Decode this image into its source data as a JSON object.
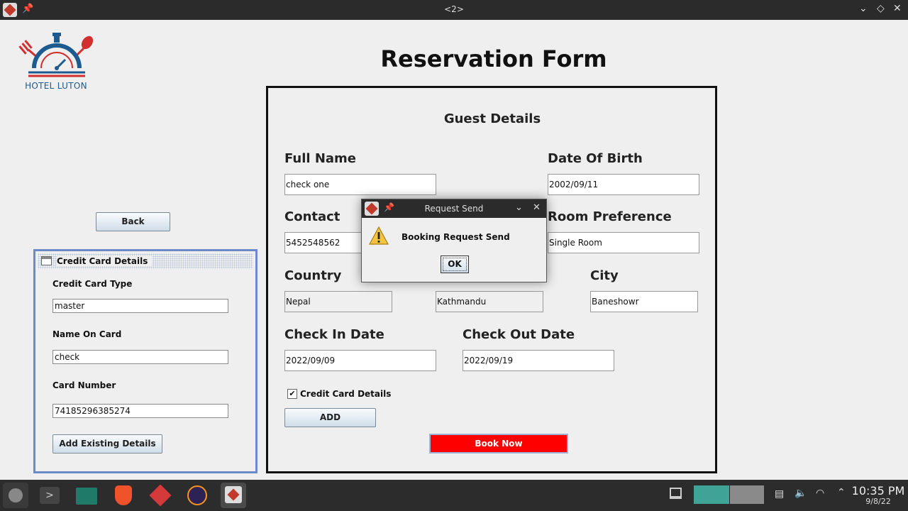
{
  "window": {
    "title": "<2>"
  },
  "logo": {
    "text": "HOTEL LUTON"
  },
  "page": {
    "heading": "Reservation Form"
  },
  "back_button": {
    "label": "Back"
  },
  "credit_card": {
    "title": "Credit Card Details",
    "type_label": "Credit Card Type",
    "type_value": "master",
    "name_label": "Name On Card",
    "name_value": "check",
    "number_label": "Card Number",
    "number_value": "74185296385274",
    "add_existing_label": "Add Existing Details"
  },
  "form": {
    "section_title": "Guest Details",
    "full_name_label": "Full Name",
    "full_name_value": "check one",
    "dob_label": "Date Of Birth",
    "dob_value": "2002/09/11",
    "contact_label": "Contact",
    "contact_value": "5452548562",
    "room_pref_label": "Room Preference",
    "room_pref_value": "Single Room",
    "country_label": "Country",
    "country_value": "Nepal",
    "state_value": "Kathmandu",
    "city_label": "City",
    "city_value": "Baneshowr",
    "checkin_label": "Check In Date",
    "checkin_value": "2022/09/09",
    "checkout_label": "Check Out Date",
    "checkout_value": "2022/09/19",
    "cc_checkbox_label": "Credit Card Details",
    "cc_checkbox_checked": true,
    "add_label": "ADD",
    "book_label": "Book Now"
  },
  "dialog": {
    "title": "Request Send",
    "message": "Booking Request Send",
    "ok_label": "OK"
  },
  "taskbar": {
    "time": "10:35 PM",
    "date": "9/8/22"
  },
  "colors": {
    "book_button": "#ff0000",
    "frame_border": "#6b8ac6",
    "logo_blue": "#1c5a8f",
    "logo_red": "#d32f2f"
  }
}
